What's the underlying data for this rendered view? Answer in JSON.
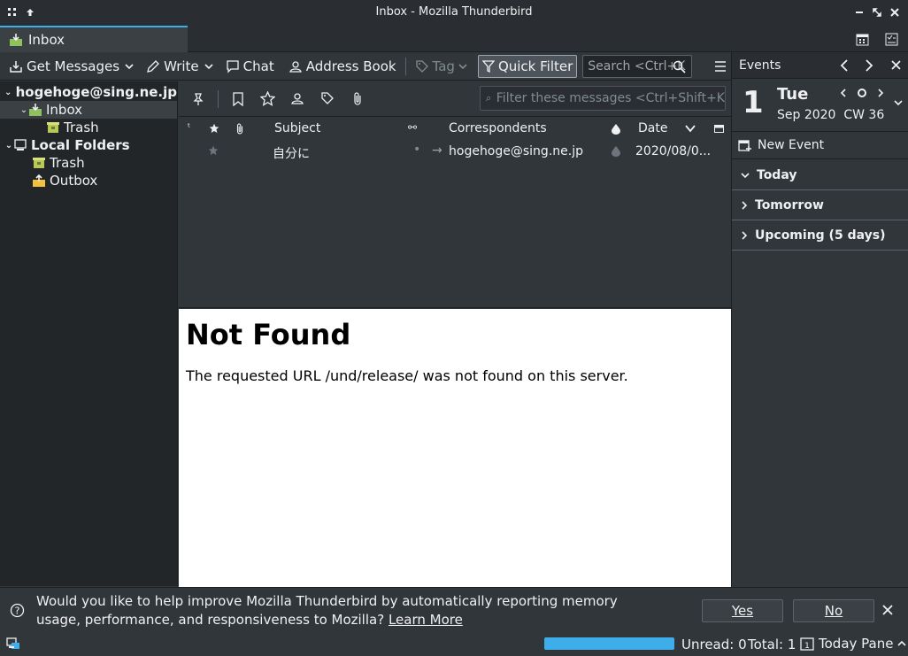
{
  "window": {
    "title": "Inbox - Mozilla Thunderbird"
  },
  "tabs": [
    {
      "label": "Inbox"
    }
  ],
  "toolbar": {
    "get_messages": "Get Messages",
    "write": "Write",
    "chat": "Chat",
    "address_book": "Address Book",
    "tag": "Tag",
    "quick_filter": "Quick Filter",
    "search_placeholder": "Search <Ctrl+K"
  },
  "folders": {
    "account": "hogehoge@sing.ne.jp",
    "inbox": "Inbox",
    "inbox_trash": "Trash",
    "local_folders": "Local Folders",
    "local_trash": "Trash",
    "outbox": "Outbox"
  },
  "quick_filter": {
    "placeholder": "Filter these messages <Ctrl+Shift+K"
  },
  "columns": {
    "subject": "Subject",
    "correspondents": "Correspondents",
    "date": "Date"
  },
  "messages": [
    {
      "subject": "自分に",
      "correspondent": "hogehoge@sing.ne.jp",
      "date": "2020/08/0..."
    }
  ],
  "preview": {
    "heading": "Not Found",
    "body": "The requested URL /und/release/ was not found on this server."
  },
  "today_pane": {
    "header": "Events",
    "day_number": "1",
    "weekday": "Tue",
    "month_year_week": "Sep 2020  CW 36",
    "new_event": "New Event",
    "sections": [
      "Today",
      "Tomorrow",
      "Upcoming (5 days)"
    ]
  },
  "notification": {
    "message": "Would you like to help improve Mozilla Thunderbird by automatically reporting memory usage, performance, and responsiveness to Mozilla?",
    "learn_more": "Learn More",
    "yes": "Yes",
    "no": "No"
  },
  "status": {
    "unread": "Unread: 0",
    "total": "Total: 1",
    "today_pane": "Today Pane",
    "progress": 1.0
  },
  "colors": {
    "accent": "#3daee9",
    "background": "#31363b",
    "panel": "#232629"
  }
}
